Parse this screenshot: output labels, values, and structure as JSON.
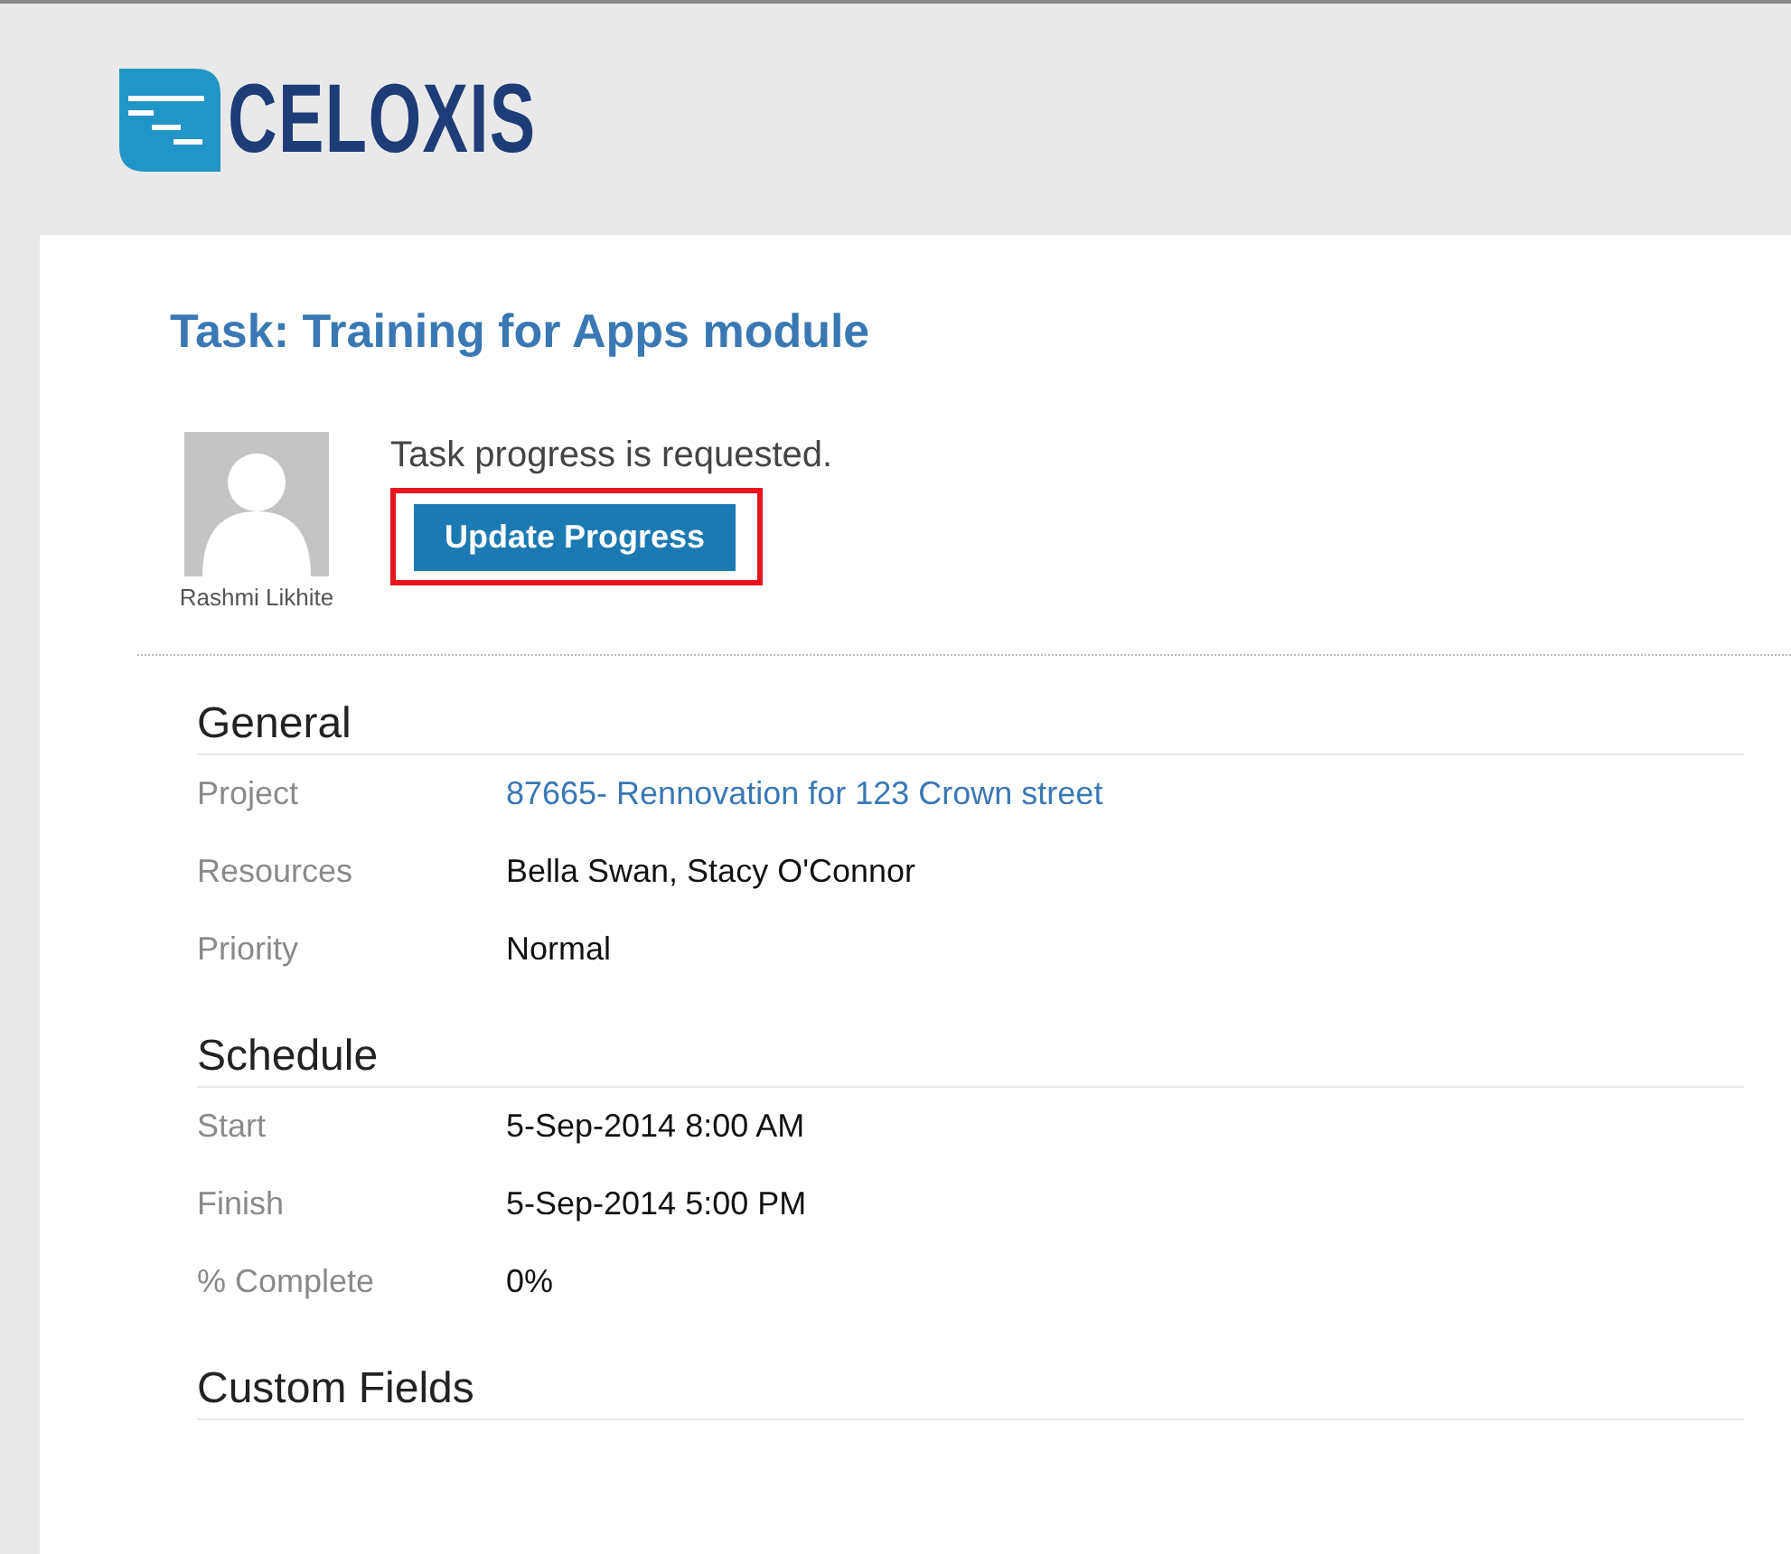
{
  "logo": {
    "text": "CELOXIS"
  },
  "task": {
    "title": "Task: Training for Apps module",
    "user": "Rashmi Likhite",
    "message": "Task progress is requested.",
    "button": {
      "label": "Update Progress",
      "highlighted": true
    }
  },
  "sections": [
    {
      "title": "General",
      "fields": [
        {
          "label": "Project",
          "value": "87665- Rennovation for 123 Crown street",
          "kind": "link"
        },
        {
          "label": "Resources",
          "value": "Bella Swan, Stacy O'Connor",
          "kind": "text"
        },
        {
          "label": "Priority",
          "value": "Normal",
          "kind": "text"
        }
      ]
    },
    {
      "title": "Schedule",
      "fields": [
        {
          "label": "Start",
          "value": "5-Sep-2014 8:00 AM",
          "kind": "text"
        },
        {
          "label": "Finish",
          "value": "5-Sep-2014 5:00 PM",
          "kind": "text"
        },
        {
          "label": "% Complete",
          "value": "0%",
          "kind": "text"
        }
      ]
    },
    {
      "title": "Custom Fields"
    }
  ]
}
